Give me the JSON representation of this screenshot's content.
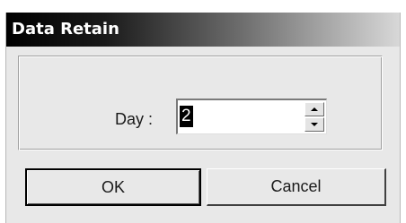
{
  "window": {
    "title": "Data Retain"
  },
  "form": {
    "day_label": "Day :",
    "day_value": "2"
  },
  "icons": {
    "spin_up": "spin-up-arrow-icon",
    "spin_down": "spin-down-arrow-icon"
  },
  "buttons": {
    "ok_label": "OK",
    "cancel_label": "Cancel"
  },
  "colors": {
    "titlebar_start": "#000000",
    "titlebar_end": "#d8d8d8",
    "dialog_bg": "#e8e8e8"
  }
}
